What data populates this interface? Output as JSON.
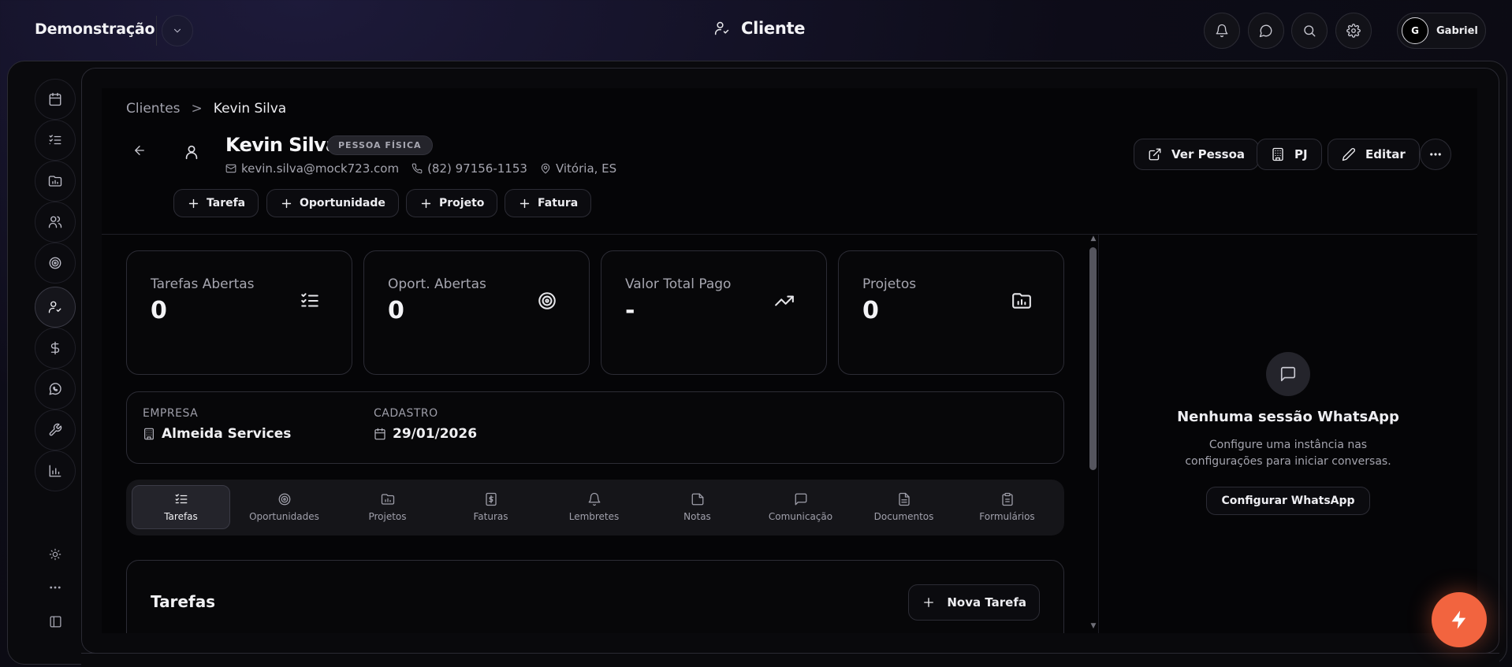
{
  "header": {
    "workspace": "Demonstração",
    "page_title": "Cliente",
    "user": {
      "initial": "G",
      "name": "Gabriel"
    }
  },
  "breadcrumb": {
    "parent": "Clientes",
    "separator": ">",
    "current": "Kevin Silva"
  },
  "client": {
    "name": "Kevin Silva",
    "type": "PESSOA FÍSICA",
    "email": "kevin.silva@mock723.com",
    "phone": "(82) 97156-1153",
    "location": "Vitória, ES"
  },
  "quick_actions": [
    "Tarefa",
    "Oportunidade",
    "Projeto",
    "Fatura"
  ],
  "actions": {
    "view_person": "Ver Pessoa",
    "pj": "PJ",
    "edit": "Editar"
  },
  "stats": [
    {
      "label": "Tarefas Abertas",
      "value": "0",
      "icon": "list-check-icon"
    },
    {
      "label": "Oport. Abertas",
      "value": "0",
      "icon": "target-icon"
    },
    {
      "label": "Valor Total Pago",
      "value": "-",
      "icon": "trending-up-icon"
    },
    {
      "label": "Projetos",
      "value": "0",
      "icon": "folder-chart-icon"
    }
  ],
  "info": {
    "company_label": "EMPRESA",
    "company": "Almeida Services",
    "registered_label": "CADASTRO",
    "registered": "29/01/2026"
  },
  "tabs": [
    "Tarefas",
    "Oportunidades",
    "Projetos",
    "Faturas",
    "Lembretes",
    "Notas",
    "Comunicação",
    "Documentos",
    "Formulários"
  ],
  "active_tab": "Tarefas",
  "tasks": {
    "title": "Tarefas",
    "new_label": "Nova Tarefa"
  },
  "whatsapp": {
    "title": "Nenhuma sessão WhatsApp",
    "desc_line1": "Configure uma instância nas",
    "desc_line2": "configurações para iniciar conversas.",
    "button": "Configurar WhatsApp"
  },
  "colors": {
    "accent": "#f2643f",
    "background": "#0a0a0d",
    "card_border": "#2c2c35"
  }
}
